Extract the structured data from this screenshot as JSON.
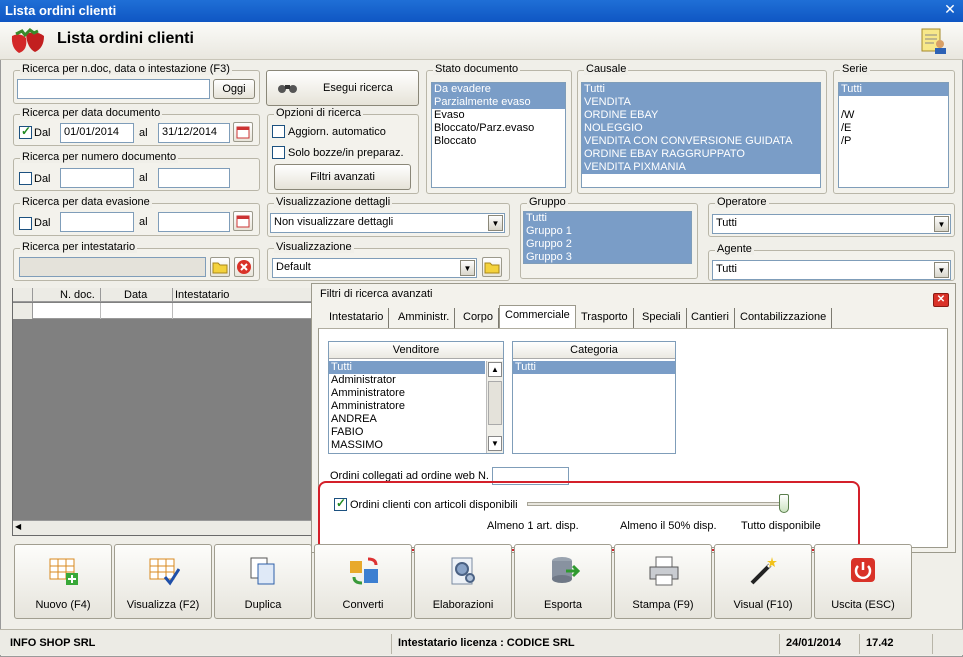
{
  "window": {
    "title": "Lista ordini clienti",
    "header_title": "Lista ordini clienti"
  },
  "search_ndoc": {
    "label": "Ricerca per n.doc, data o intestazione (F3)",
    "value": "",
    "button": "Oggi"
  },
  "search_button": "Esegui ricerca",
  "search_date_doc": {
    "label": "Ricerca per data documento",
    "from_label": "Dal",
    "from": "01/01/2014",
    "to_label": "al",
    "to": "31/12/2014"
  },
  "search_num_doc": {
    "label": "Ricerca per numero documento",
    "from_label": "Dal",
    "to_label": "al"
  },
  "search_date_evasione": {
    "label": "Ricerca per data evasione",
    "from_label": "Dal",
    "to_label": "al"
  },
  "search_intestatario": {
    "label": "Ricerca per intestatario"
  },
  "options": {
    "label": "Opzioni di ricerca",
    "auto_update": "Aggiorn. automatico",
    "drafts_only": "Solo bozze/in preparaz.",
    "advanced_button": "Filtri avanzati"
  },
  "stato_documento": {
    "label": "Stato documento",
    "items": [
      "Da evadere",
      "Parzialmente evaso",
      "Evaso",
      "Bloccato/Parz.evaso",
      "Bloccato"
    ]
  },
  "causale": {
    "label": "Causale",
    "items": [
      "Tutti",
      "VENDITA",
      "ORDINE EBAY",
      "NOLEGGIO",
      "VENDITA CON CONVERSIONE GUIDATA",
      "ORDINE EBAY RAGGRUPPATO",
      "VENDITA PIXMANIA"
    ]
  },
  "serie": {
    "label": "Serie",
    "items": [
      "Tutti",
      "",
      "/W",
      "/E",
      "/P"
    ]
  },
  "visualizzazione_dettagli": {
    "label": "Visualizzazione dettagli",
    "value": "Non visualizzare dettagli"
  },
  "visualizzazione": {
    "label": "Visualizzazione",
    "value": "Default"
  },
  "gruppo": {
    "label": "Gruppo",
    "items": [
      "Tutti",
      "Gruppo 1",
      "Gruppo 2",
      "Gruppo 3"
    ]
  },
  "operatore": {
    "label": "Operatore",
    "value": "Tutti"
  },
  "agente": {
    "label": "Agente",
    "value": "Tutti"
  },
  "grid": {
    "columns": [
      "N. doc.",
      "Data",
      "Intestatario"
    ]
  },
  "advanced": {
    "title": "Filtri di ricerca avanzati",
    "tabs": [
      "Intestatario",
      "Amministr.",
      "Corpo",
      "Commerciale",
      "Trasporto",
      "Speciali",
      "Cantieri",
      "Contabilizzazione"
    ],
    "venditore": {
      "header": "Venditore",
      "items": [
        "Tutti",
        "Administrator",
        "Amministratore",
        "Amministratore",
        "ANDREA",
        "FABIO",
        "MASSIMO"
      ]
    },
    "categoria": {
      "header": "Categoria",
      "items": [
        "Tutti"
      ]
    },
    "web_order_label": "Ordini collegati ad ordine web N.",
    "available_label": "Ordini clienti con articoli disponibili",
    "slider_labels": [
      "Almeno 1 art. disp.",
      "Almeno il 50% disp.",
      "Tutto disponibile"
    ],
    "slider_level": 1.0
  },
  "toolbar": [
    "Nuovo (F4)",
    "Visualizza (F2)",
    "Duplica",
    "Converti",
    "Elaborazioni",
    "Esporta",
    "Stampa (F9)",
    "Visual (F10)",
    "Uscita (ESC)"
  ],
  "status": {
    "company": "INFO SHOP SRL",
    "license": "Intestatario licenza : CODICE SRL",
    "date": "24/01/2014",
    "time": "17.42"
  }
}
